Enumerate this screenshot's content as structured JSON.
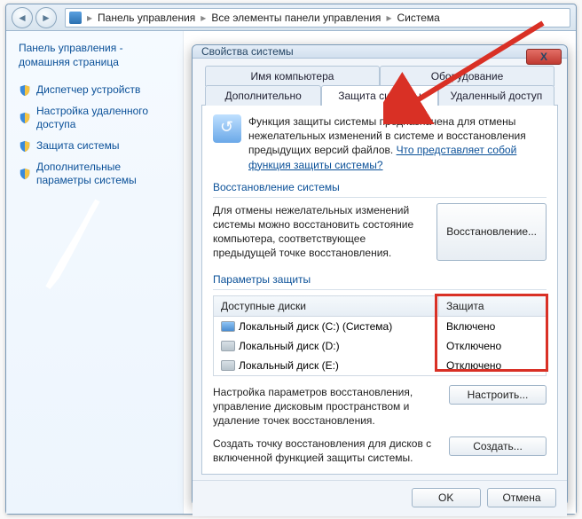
{
  "breadcrumbs": {
    "item0": "Панель управления",
    "item1": "Все элементы панели управления",
    "item2": "Система"
  },
  "sidebar": {
    "title": "Панель управления - домашняя страница",
    "items": [
      "Диспетчер устройств",
      "Настройка удаленного доступа",
      "Защита системы",
      "Дополнительные параметры системы"
    ]
  },
  "dialog": {
    "title": "Свойства системы",
    "close": "X",
    "tabs_row1": [
      "Имя компьютера",
      "Оборудование"
    ],
    "tabs_row2": [
      "Дополнительно",
      "Защита системы",
      "Удаленный доступ"
    ],
    "active_tab": "Защита системы",
    "intro": "Функция защиты системы предназначена для отмены нежелательных изменений в системе и восстановления предыдущих версий файлов. ",
    "intro_link": "Что представляет собой функция защиты системы?",
    "restore_group": "Восстановление системы",
    "restore_text": "Для отмены нежелательных изменений системы можно восстановить состояние компьютера, соответствующее предыдущей точке восстановления.",
    "restore_btn": "Восстановление...",
    "protect_group": "Параметры защиты",
    "col_drive": "Доступные диски",
    "col_protect": "Защита",
    "drives": [
      {
        "name": "Локальный диск (C:) (Система)",
        "status": "Включено",
        "sys": true
      },
      {
        "name": "Локальный диск (D:)",
        "status": "Отключено",
        "sys": false
      },
      {
        "name": "Локальный диск (E:)",
        "status": "Отключено",
        "sys": false
      }
    ],
    "configure_text": "Настройка параметров восстановления, управление дисковым пространством и удаление точек восстановления.",
    "configure_btn": "Настроить...",
    "create_text": "Создать точку восстановления для дисков с включенной функцией защиты системы.",
    "create_btn": "Создать...",
    "ok": "OK",
    "cancel": "Отмена"
  }
}
